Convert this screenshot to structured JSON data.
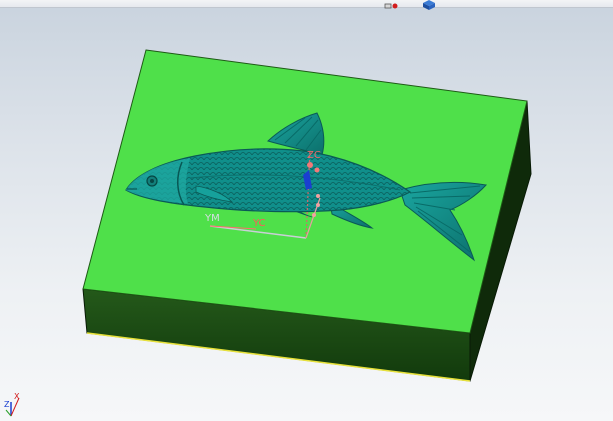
{
  "viewport": {
    "background_top": "#c9d3de",
    "background_bottom": "#f6f7f9"
  },
  "toolbar": {
    "icons": [
      "selection-filter-icon",
      "view-cube-icon"
    ]
  },
  "model": {
    "block_top_color": "#4fe04a",
    "block_front_color": "#1d4d12",
    "block_side_color": "#0f2a0a",
    "relief_color": "#0f8f8a",
    "relief_subject": "fish"
  },
  "csys": {
    "labels": {
      "ym": "YM",
      "yc": "YC",
      "zc": "ZC"
    }
  },
  "wcs": {
    "labels": {
      "x": "X",
      "z": "Z"
    }
  }
}
